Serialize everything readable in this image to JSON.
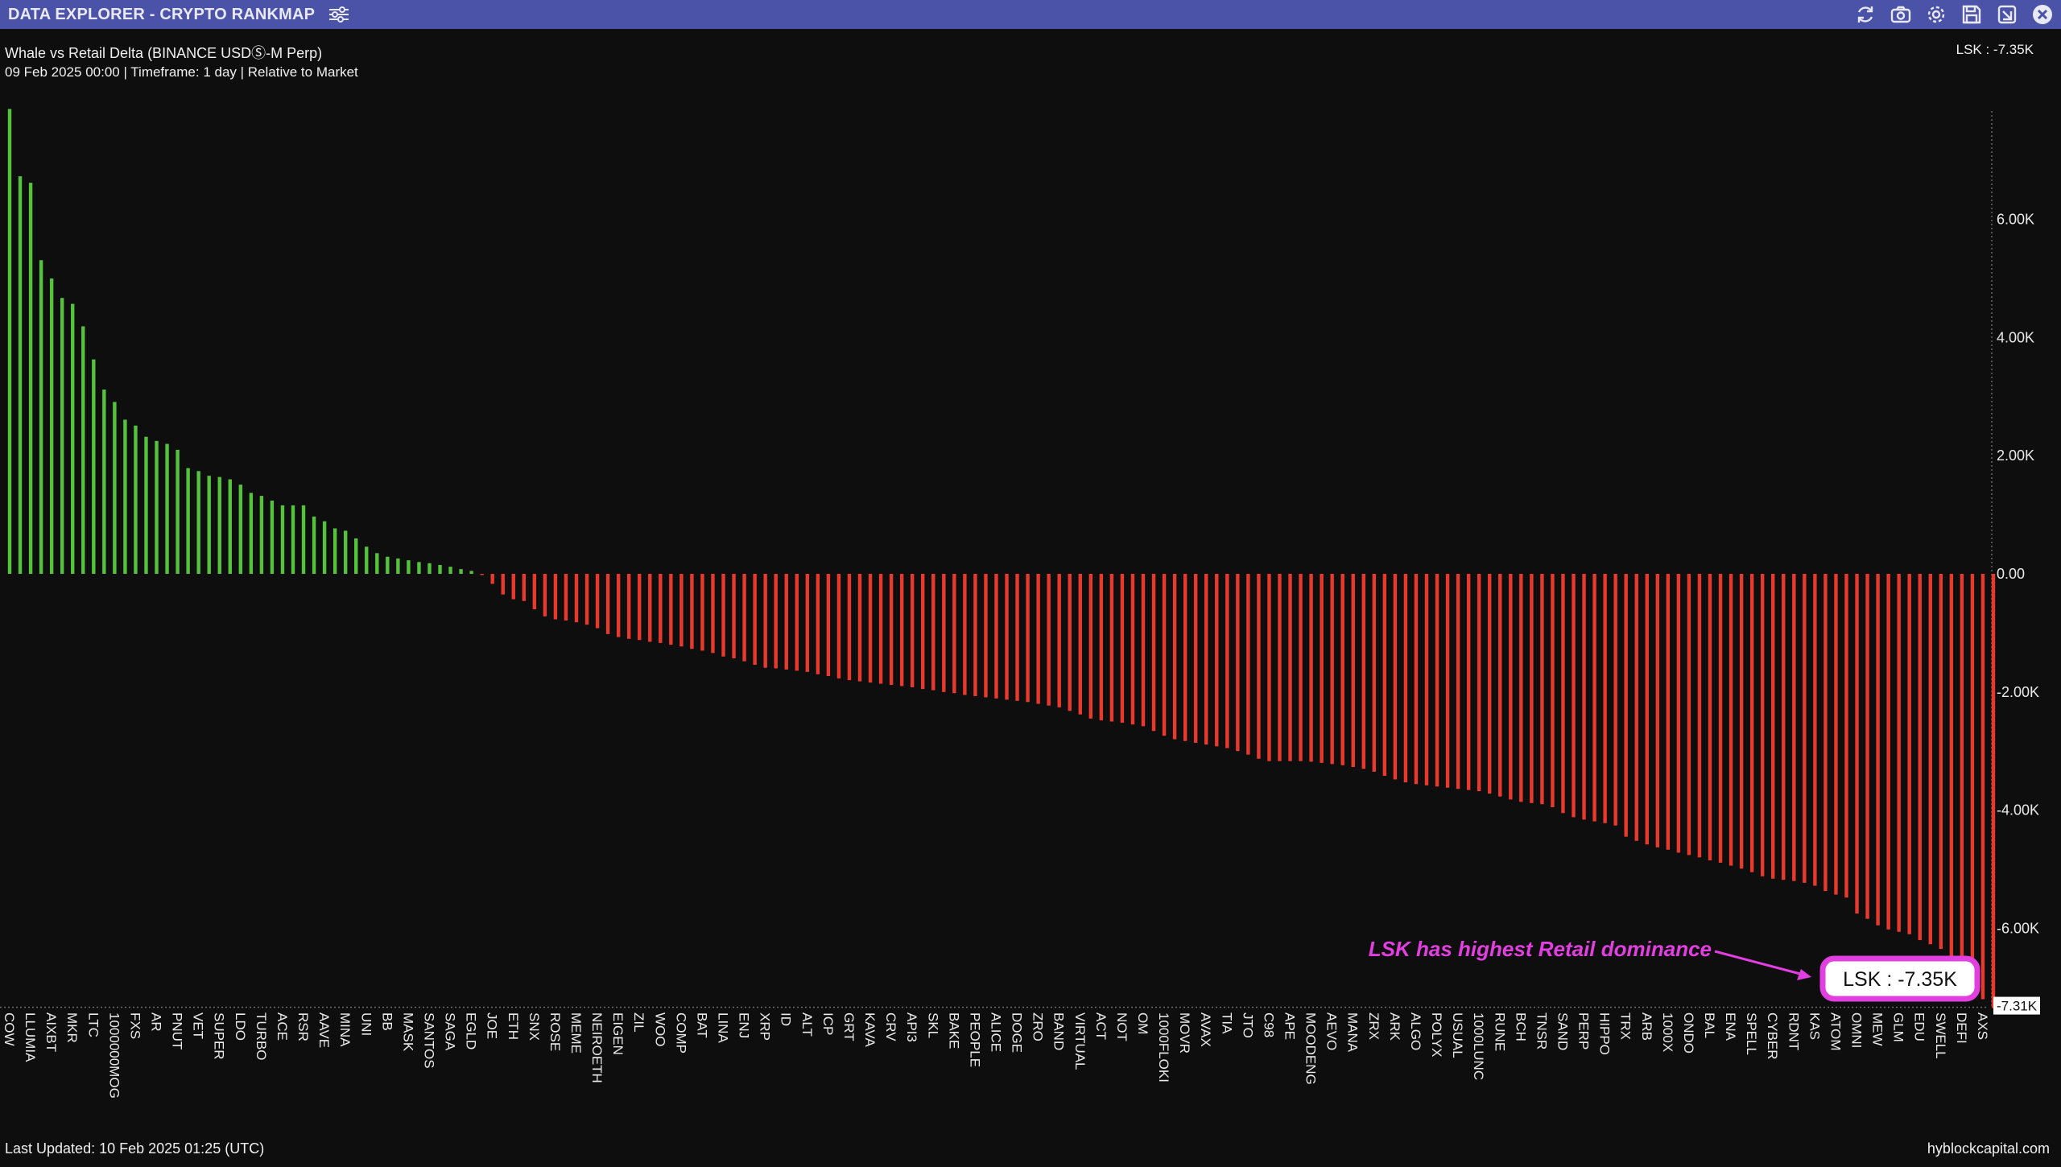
{
  "window": {
    "title": "DATA EXPLORER - CRYPTO RANKMAP"
  },
  "toolbar": {
    "icons": [
      "refresh-icon",
      "camera-icon",
      "gear-icon",
      "save-icon",
      "download-icon",
      "close-icon"
    ]
  },
  "header": {
    "subtitle": "Whale vs Retail Delta (BINANCE USDⓈ-M Perp)",
    "meta": "09 Feb 2025 00:00 | Timeframe: 1 day | Relative to Market",
    "cursor_readout": "LSK : -7.35K"
  },
  "footer": {
    "last_updated": "Last Updated: 10 Feb 2025 01:25 (UTC)",
    "brand": "hyblockcapital.com"
  },
  "colors": {
    "positive": "#55c23b",
    "negative": "#e8392c",
    "annotation": "#e23fe0",
    "title_bar": "#4b53a8"
  },
  "annotation": {
    "text": "LSK has highest Retail dominance",
    "callout": "LSK : -7.35K"
  },
  "chart_data": {
    "type": "bar",
    "title": "Whale vs Retail Delta (BINANCE USDⓈ-M Perp)",
    "xlabel": "",
    "ylabel": "",
    "ylim": [
      -7.31,
      7.9
    ],
    "yticks": [
      6,
      4,
      2,
      0,
      -2,
      -4,
      -6
    ],
    "ytick_labels": [
      "6.00K",
      "4.00K",
      "2.00K",
      "0.00",
      "-2.00K",
      "-4.00K",
      "-6.00K"
    ],
    "min_label": "-7.31K",
    "grid": false,
    "unit": "K",
    "bars": [
      {
        "name": "COW",
        "value": 7.87,
        "label": true
      },
      {
        "name": "",
        "value": 6.73
      },
      {
        "name": "LLUMIA",
        "value": 6.62,
        "label": true
      },
      {
        "name": "",
        "value": 5.31
      },
      {
        "name": "AIXBT",
        "value": 5.0,
        "label": true
      },
      {
        "name": "",
        "value": 4.67
      },
      {
        "name": "MKR",
        "value": 4.57,
        "label": true
      },
      {
        "name": "",
        "value": 4.19
      },
      {
        "name": "LTC",
        "value": 3.63,
        "label": true
      },
      {
        "name": "",
        "value": 3.12
      },
      {
        "name": "1000000MOG",
        "value": 2.91,
        "label": true
      },
      {
        "name": "",
        "value": 2.61
      },
      {
        "name": "FXS",
        "value": 2.51,
        "label": true
      },
      {
        "name": "",
        "value": 2.32
      },
      {
        "name": "AR",
        "value": 2.25,
        "label": true
      },
      {
        "name": "",
        "value": 2.2
      },
      {
        "name": "PNUT",
        "value": 2.1,
        "label": true
      },
      {
        "name": "",
        "value": 1.79
      },
      {
        "name": "VET",
        "value": 1.74,
        "label": true
      },
      {
        "name": "",
        "value": 1.66
      },
      {
        "name": "SUPER",
        "value": 1.64,
        "label": true
      },
      {
        "name": "",
        "value": 1.6
      },
      {
        "name": "LDO",
        "value": 1.51,
        "label": true
      },
      {
        "name": "",
        "value": 1.37
      },
      {
        "name": "TURBO",
        "value": 1.32,
        "label": true
      },
      {
        "name": "",
        "value": 1.24
      },
      {
        "name": "ACE",
        "value": 1.16,
        "label": true
      },
      {
        "name": "",
        "value": 1.16
      },
      {
        "name": "RSR",
        "value": 1.16,
        "label": true
      },
      {
        "name": "",
        "value": 0.97
      },
      {
        "name": "AAVE",
        "value": 0.89,
        "label": true
      },
      {
        "name": "",
        "value": 0.77
      },
      {
        "name": "MINA",
        "value": 0.73,
        "label": true
      },
      {
        "name": "",
        "value": 0.6
      },
      {
        "name": "UNI",
        "value": 0.46,
        "label": true
      },
      {
        "name": "",
        "value": 0.35
      },
      {
        "name": "BB",
        "value": 0.29,
        "label": true
      },
      {
        "name": "",
        "value": 0.26
      },
      {
        "name": "MASK",
        "value": 0.23,
        "label": true
      },
      {
        "name": "",
        "value": 0.2
      },
      {
        "name": "SANTOS",
        "value": 0.18,
        "label": true
      },
      {
        "name": "",
        "value": 0.15
      },
      {
        "name": "SAGA",
        "value": 0.12,
        "label": true
      },
      {
        "name": "",
        "value": 0.08
      },
      {
        "name": "EGLD",
        "value": 0.05,
        "label": true
      },
      {
        "name": "",
        "value": -0.02
      },
      {
        "name": "JOE",
        "value": -0.17,
        "label": true
      },
      {
        "name": "",
        "value": -0.35
      },
      {
        "name": "ETH",
        "value": -0.43,
        "label": true
      },
      {
        "name": "",
        "value": -0.46
      },
      {
        "name": "SNX",
        "value": -0.6,
        "label": true
      },
      {
        "name": "",
        "value": -0.72
      },
      {
        "name": "ROSE",
        "value": -0.77,
        "label": true
      },
      {
        "name": "",
        "value": -0.79
      },
      {
        "name": "MEME",
        "value": -0.82,
        "label": true
      },
      {
        "name": "",
        "value": -0.86
      },
      {
        "name": "NEIROETH",
        "value": -0.92,
        "label": true
      },
      {
        "name": "",
        "value": -1.02
      },
      {
        "name": "EIGEN",
        "value": -1.07,
        "label": true
      },
      {
        "name": "",
        "value": -1.1
      },
      {
        "name": "ZIL",
        "value": -1.12,
        "label": true
      },
      {
        "name": "",
        "value": -1.15
      },
      {
        "name": "WOO",
        "value": -1.17,
        "label": true
      },
      {
        "name": "",
        "value": -1.2
      },
      {
        "name": "COMP",
        "value": -1.23,
        "label": true
      },
      {
        "name": "",
        "value": -1.27
      },
      {
        "name": "BAT",
        "value": -1.3,
        "label": true
      },
      {
        "name": "",
        "value": -1.34
      },
      {
        "name": "LINA",
        "value": -1.4,
        "label": true
      },
      {
        "name": "",
        "value": -1.43
      },
      {
        "name": "ENJ",
        "value": -1.48,
        "label": true
      },
      {
        "name": "",
        "value": -1.54
      },
      {
        "name": "XRP",
        "value": -1.59,
        "label": true
      },
      {
        "name": "",
        "value": -1.6
      },
      {
        "name": "ID",
        "value": -1.62,
        "label": true
      },
      {
        "name": "",
        "value": -1.64
      },
      {
        "name": "ALT",
        "value": -1.66,
        "label": true
      },
      {
        "name": "",
        "value": -1.7
      },
      {
        "name": "ICP",
        "value": -1.73,
        "label": true
      },
      {
        "name": "",
        "value": -1.77
      },
      {
        "name": "GRT",
        "value": -1.8,
        "label": true
      },
      {
        "name": "",
        "value": -1.82
      },
      {
        "name": "KAVA",
        "value": -1.84,
        "label": true
      },
      {
        "name": "",
        "value": -1.86
      },
      {
        "name": "CRV",
        "value": -1.88,
        "label": true
      },
      {
        "name": "",
        "value": -1.9
      },
      {
        "name": "API3",
        "value": -1.92,
        "label": true
      },
      {
        "name": "",
        "value": -1.95
      },
      {
        "name": "SKL",
        "value": -1.97,
        "label": true
      },
      {
        "name": "",
        "value": -2.0
      },
      {
        "name": "BAKE",
        "value": -2.02,
        "label": true
      },
      {
        "name": "",
        "value": -2.05
      },
      {
        "name": "PEOPLE",
        "value": -2.07,
        "label": true
      },
      {
        "name": "",
        "value": -2.09
      },
      {
        "name": "ALICE",
        "value": -2.11,
        "label": true
      },
      {
        "name": "",
        "value": -2.13
      },
      {
        "name": "DOGE",
        "value": -2.15,
        "label": true
      },
      {
        "name": "",
        "value": -2.17
      },
      {
        "name": "ZRO",
        "value": -2.2,
        "label": true
      },
      {
        "name": "",
        "value": -2.23
      },
      {
        "name": "BAND",
        "value": -2.26,
        "label": true
      },
      {
        "name": "",
        "value": -2.32
      },
      {
        "name": "VIRTUAL",
        "value": -2.38,
        "label": true
      },
      {
        "name": "",
        "value": -2.45
      },
      {
        "name": "ACT",
        "value": -2.48,
        "label": true
      },
      {
        "name": "",
        "value": -2.5
      },
      {
        "name": "NOT",
        "value": -2.52,
        "label": true
      },
      {
        "name": "",
        "value": -2.55
      },
      {
        "name": "OM",
        "value": -2.58,
        "label": true
      },
      {
        "name": "",
        "value": -2.66
      },
      {
        "name": "1000FLOKI",
        "value": -2.74,
        "label": true
      },
      {
        "name": "",
        "value": -2.8
      },
      {
        "name": "MOVR",
        "value": -2.83,
        "label": true
      },
      {
        "name": "",
        "value": -2.86
      },
      {
        "name": "AVAX",
        "value": -2.89,
        "label": true
      },
      {
        "name": "",
        "value": -2.92
      },
      {
        "name": "TIA",
        "value": -2.95,
        "label": true
      },
      {
        "name": "",
        "value": -3.0
      },
      {
        "name": "JTO",
        "value": -3.06,
        "label": true
      },
      {
        "name": "",
        "value": -3.13
      },
      {
        "name": "C98",
        "value": -3.17,
        "label": true
      },
      {
        "name": "",
        "value": -3.17
      },
      {
        "name": "APE",
        "value": -3.17,
        "label": true
      },
      {
        "name": "",
        "value": -3.17
      },
      {
        "name": "MOODENG",
        "value": -3.18,
        "label": true
      },
      {
        "name": "",
        "value": -3.2
      },
      {
        "name": "AEVO",
        "value": -3.22,
        "label": true
      },
      {
        "name": "",
        "value": -3.24
      },
      {
        "name": "MANA",
        "value": -3.27,
        "label": true
      },
      {
        "name": "",
        "value": -3.3
      },
      {
        "name": "ZRX",
        "value": -3.35,
        "label": true
      },
      {
        "name": "",
        "value": -3.42
      },
      {
        "name": "ARK",
        "value": -3.48,
        "label": true
      },
      {
        "name": "",
        "value": -3.53
      },
      {
        "name": "ALGO",
        "value": -3.56,
        "label": true
      },
      {
        "name": "",
        "value": -3.58
      },
      {
        "name": "POLYX",
        "value": -3.6,
        "label": true
      },
      {
        "name": "",
        "value": -3.62
      },
      {
        "name": "USUAL",
        "value": -3.64,
        "label": true
      },
      {
        "name": "",
        "value": -3.66
      },
      {
        "name": "1000LUNC",
        "value": -3.68,
        "label": true
      },
      {
        "name": "",
        "value": -3.72
      },
      {
        "name": "RUNE",
        "value": -3.77,
        "label": true
      },
      {
        "name": "",
        "value": -3.82
      },
      {
        "name": "BCH",
        "value": -3.86,
        "label": true
      },
      {
        "name": "",
        "value": -3.88
      },
      {
        "name": "TNSR",
        "value": -3.9,
        "label": true
      },
      {
        "name": "",
        "value": -3.95
      },
      {
        "name": "SAND",
        "value": -4.05,
        "label": true
      },
      {
        "name": "",
        "value": -4.12
      },
      {
        "name": "PERP",
        "value": -4.16,
        "label": true
      },
      {
        "name": "",
        "value": -4.19
      },
      {
        "name": "HIPPO",
        "value": -4.22,
        "label": true
      },
      {
        "name": "",
        "value": -4.26
      },
      {
        "name": "TRX",
        "value": -4.45,
        "label": true
      },
      {
        "name": "",
        "value": -4.52
      },
      {
        "name": "ARB",
        "value": -4.58,
        "label": true
      },
      {
        "name": "",
        "value": -4.63
      },
      {
        "name": "1000X",
        "value": -4.67,
        "label": true
      },
      {
        "name": "",
        "value": -4.72
      },
      {
        "name": "ONDO",
        "value": -4.76,
        "label": true
      },
      {
        "name": "",
        "value": -4.8
      },
      {
        "name": "BAL",
        "value": -4.85,
        "label": true
      },
      {
        "name": "",
        "value": -4.89
      },
      {
        "name": "ENA",
        "value": -4.94,
        "label": true
      },
      {
        "name": "",
        "value": -4.99
      },
      {
        "name": "SPELL",
        "value": -5.05,
        "label": true
      },
      {
        "name": "",
        "value": -5.12
      },
      {
        "name": "CYBER",
        "value": -5.16,
        "label": true
      },
      {
        "name": "",
        "value": -5.18
      },
      {
        "name": "RDNT",
        "value": -5.2,
        "label": true
      },
      {
        "name": "",
        "value": -5.23
      },
      {
        "name": "KAS",
        "value": -5.28,
        "label": true
      },
      {
        "name": "",
        "value": -5.37
      },
      {
        "name": "ATOM",
        "value": -5.43,
        "label": true
      },
      {
        "name": "",
        "value": -5.48
      },
      {
        "name": "OMNI",
        "value": -5.75,
        "label": true
      },
      {
        "name": "",
        "value": -5.84
      },
      {
        "name": "MEW",
        "value": -5.95,
        "label": true
      },
      {
        "name": "",
        "value": -6.02
      },
      {
        "name": "GLM",
        "value": -6.06,
        "label": true
      },
      {
        "name": "",
        "value": -6.1
      },
      {
        "name": "EDU",
        "value": -6.2,
        "label": true
      },
      {
        "name": "",
        "value": -6.27
      },
      {
        "name": "SWELL",
        "value": -6.35,
        "label": true
      },
      {
        "name": "",
        "value": -6.5
      },
      {
        "name": "DEFI",
        "value": -6.75,
        "label": true
      },
      {
        "name": "",
        "value": -7.05
      },
      {
        "name": "AXS",
        "value": -7.2,
        "label": true
      },
      {
        "name": "LSK",
        "value": -7.35
      }
    ]
  }
}
